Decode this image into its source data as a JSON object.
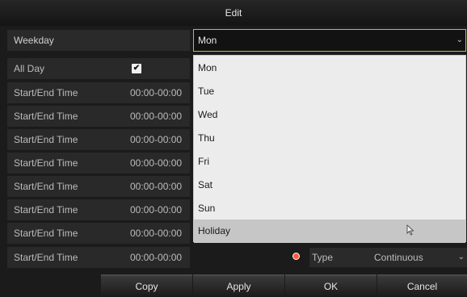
{
  "dialog": {
    "title": "Edit"
  },
  "weekday": {
    "label": "Weekday",
    "selected": "Mon"
  },
  "all_day": {
    "label": "All Day",
    "checked": true,
    "check_glyph": "✔"
  },
  "rows": [
    {
      "label": "Start/End Time",
      "value": "00:00-00:00"
    },
    {
      "label": "Start/End Time",
      "value": "00:00-00:00"
    },
    {
      "label": "Start/End Time",
      "value": "00:00-00:00"
    },
    {
      "label": "Start/End Time",
      "value": "00:00-00:00"
    },
    {
      "label": "Start/End Time",
      "value": "00:00-00:00"
    },
    {
      "label": "Start/End Time",
      "value": "00:00-00:00"
    },
    {
      "label": "Start/End Time",
      "value": "00:00-00:00"
    },
    {
      "label": "Start/End Time",
      "value": "00:00-00:00"
    }
  ],
  "dropdown": {
    "options": [
      "Mon",
      "Tue",
      "Wed",
      "Thu",
      "Fri",
      "Sat",
      "Sun",
      "Holiday"
    ],
    "highlighted": "Holiday"
  },
  "type": {
    "label": "Type",
    "value": "Continuous"
  },
  "buttons": {
    "copy": "Copy",
    "apply": "Apply",
    "ok": "OK",
    "cancel": "Cancel"
  },
  "icons": {
    "select_arrow": "chevron-down-icon",
    "clock": "clock-icon",
    "cursor": "mouse-pointer-icon"
  },
  "colors": {
    "focus_border": "#a6c83a",
    "dropdown_bg": "#ececec",
    "highlight": "#c6c6c6",
    "clock": "#ff5a3c"
  }
}
